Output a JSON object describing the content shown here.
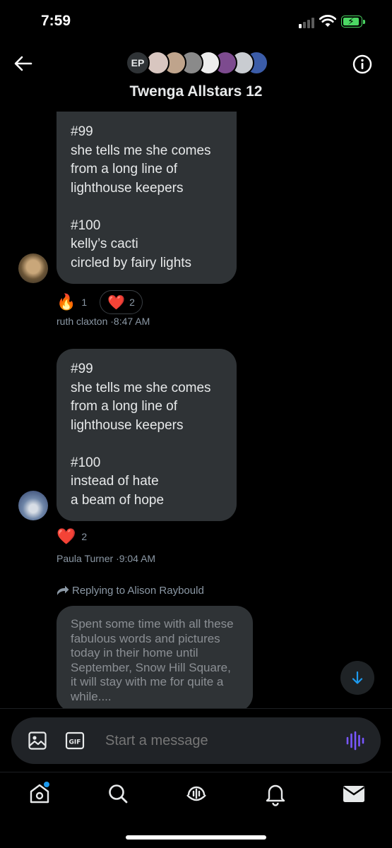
{
  "status_bar": {
    "time": "7:59"
  },
  "header": {
    "avatar_initials": "EP",
    "title": "Twenga Allstars 12"
  },
  "messages": [
    {
      "text": "#99\nshe tells me she comes\nfrom a long line of\nlighthouse keepers\n\n#100\nkelly’s cacti\ncircled by fairy lights",
      "reactions": [
        {
          "emoji": "🔥",
          "count": "1"
        },
        {
          "emoji": "❤️",
          "count": "2"
        }
      ],
      "author": "ruth claxton",
      "time": "·8:47 AM"
    },
    {
      "text": "#99\nshe tells me she comes\nfrom a long line of\nlighthouse keepers\n\n#100\ninstead of hate\na beam of hope",
      "reactions": [
        {
          "emoji": "❤️",
          "count": "2"
        }
      ],
      "author": "Paula Turner",
      "time": "·9:04 AM"
    }
  ],
  "reply": {
    "label": "Replying to Alison Raybould",
    "quoted_text": "Spent some time with all these fabulous words and pictures today in their home until September, Snow Hill Square, it will stay with me for quite a while...."
  },
  "composer": {
    "placeholder": "Start a message"
  },
  "colors": {
    "accent": "#1d9bf0",
    "voice": "#7856ff",
    "bubble": "#2f3336"
  }
}
